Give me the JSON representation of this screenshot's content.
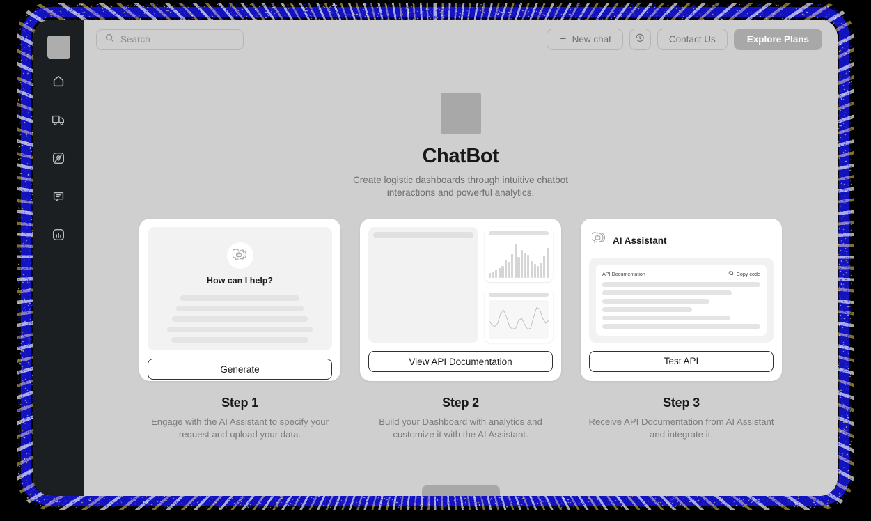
{
  "window": {
    "theme_bg": "#cfcfcf",
    "sidebar_bg": "#1c1f22",
    "accent": "#1414c8"
  },
  "sidebar": {
    "logo_name": "app-logo",
    "items": [
      {
        "icon": "home-icon",
        "name": "sidebar-item-home"
      },
      {
        "icon": "truck-icon",
        "name": "sidebar-item-shipments"
      },
      {
        "icon": "map-pin-icon",
        "name": "sidebar-item-routes"
      },
      {
        "icon": "chat-icon",
        "name": "sidebar-item-chat"
      },
      {
        "icon": "bar-chart-icon",
        "name": "sidebar-item-analytics"
      }
    ]
  },
  "header": {
    "search": {
      "placeholder": "Search",
      "value": "",
      "icon": "search-icon"
    },
    "new_chat": {
      "label": "New chat",
      "icon": "plus-icon"
    },
    "history": {
      "icon": "history-icon"
    },
    "contact": {
      "label": "Contact Us"
    },
    "explore": {
      "label": "Explore Plans"
    }
  },
  "hero": {
    "title": "ChatBot",
    "subtitle": "Create logistic dashboards through intuitive chatbot interactions and powerful analytics."
  },
  "cards": [
    {
      "name": "card-generate",
      "icon": "bot-bubble-icon",
      "prompt": "How can I help?",
      "skeletons": [
        71,
        76,
        81,
        87,
        82
      ],
      "button": "Generate",
      "step_title": "Step 1",
      "step_desc": "Engage with the AI Assistant to specify your request and upload your data."
    },
    {
      "name": "card-dashboard",
      "button": "View API Documentation",
      "step_title": "Step 2",
      "step_desc": "Build your Dashboard with analytics and customize it with the AI Assistant."
    },
    {
      "name": "card-ai-assistant",
      "icon": "bot-bubble-icon",
      "title": "AI Assistant",
      "code_label": "API Documentation",
      "copy_label": "Copy code",
      "copy_icon": "copy-icon",
      "skeletons": [
        100,
        82,
        68,
        57,
        81,
        100
      ],
      "button": "Test API",
      "step_title": "Step 3",
      "step_desc": "Receive API Documentation from AI Assistant and integrate it."
    }
  ],
  "chart_data": [
    {
      "type": "bar",
      "name": "dashboard-mini-bar-chart",
      "title": "",
      "categories": [
        "1",
        "2",
        "3",
        "4",
        "5",
        "6",
        "7",
        "8",
        "9",
        "10",
        "11",
        "12",
        "13",
        "14",
        "15",
        "16",
        "17",
        "18",
        "19"
      ],
      "values": [
        12,
        16,
        20,
        24,
        30,
        46,
        40,
        62,
        88,
        54,
        72,
        64,
        58,
        42,
        36,
        30,
        38,
        56,
        76
      ],
      "xlabel": "",
      "ylabel": "",
      "ylim": [
        0,
        100
      ],
      "grid": false,
      "legend": false
    },
    {
      "type": "line",
      "name": "dashboard-mini-line-chart",
      "title": "",
      "x": [
        0,
        1,
        2,
        3,
        4,
        5,
        6,
        7,
        8,
        9,
        10,
        11,
        12,
        13,
        14,
        15,
        16,
        17,
        18,
        19,
        20
      ],
      "values": [
        52,
        40,
        34,
        44,
        72,
        80,
        60,
        33,
        28,
        30,
        52,
        58,
        40,
        27,
        30,
        62,
        88,
        84,
        58,
        44,
        52
      ],
      "xlabel": "",
      "ylabel": "",
      "ylim": [
        0,
        100
      ],
      "grid": false,
      "legend": false
    }
  ],
  "bottom": {
    "name": "scroll-cta-button"
  }
}
